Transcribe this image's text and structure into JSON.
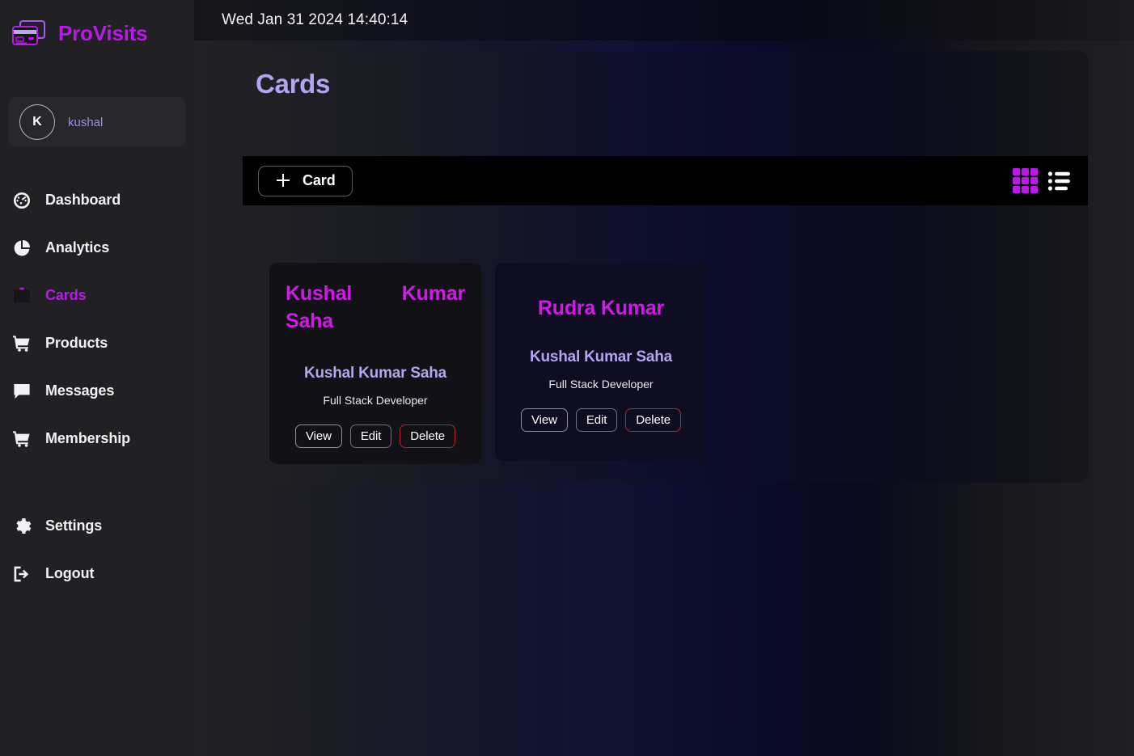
{
  "brand": {
    "name": "ProVisits",
    "icon": "credit-cards-icon",
    "color": "#bb18ea"
  },
  "sidebar": {
    "profile": {
      "avatar_initial": "K",
      "username": "kushal"
    },
    "items": [
      {
        "label": "Dashboard",
        "icon": "dashboard-icon",
        "active": false
      },
      {
        "label": "Analytics",
        "icon": "pie-chart-icon",
        "active": false
      },
      {
        "label": "Cards",
        "icon": "id-badge-icon",
        "active": true
      },
      {
        "label": "Products",
        "icon": "cart-icon",
        "active": false
      },
      {
        "label": "Messages",
        "icon": "chat-icon",
        "active": false
      },
      {
        "label": "Membership",
        "icon": "cart-icon",
        "active": false
      },
      {
        "label": "Settings",
        "icon": "gear-icon",
        "active": false
      },
      {
        "label": "Logout",
        "icon": "logout-icon",
        "active": false
      }
    ]
  },
  "topbar": {
    "clock": "Wed Jan 31 2024 14:40:14"
  },
  "panel": {
    "title": "Cards",
    "title_color": "#b3a5f2"
  },
  "toolbar": {
    "add_card_label": "Card",
    "add_icon": "plus-icon",
    "grid_view": {
      "icon": "grid-view-icon",
      "active": true,
      "color": "#bb18ea"
    },
    "list_view": {
      "icon": "list-view-icon",
      "active": false,
      "color": "#ffffff"
    }
  },
  "cards": [
    {
      "title": "Kushal Kumar Saha",
      "name": "Kushal Kumar Saha",
      "role": "Full Stack Developer",
      "actions": {
        "view": "View",
        "edit": "Edit",
        "delete": "Delete"
      }
    },
    {
      "title": "Rudra Kumar",
      "name": "Kushal Kumar Saha",
      "role": "Full Stack Developer",
      "actions": {
        "view": "View",
        "edit": "Edit",
        "delete": "Delete"
      }
    }
  ]
}
